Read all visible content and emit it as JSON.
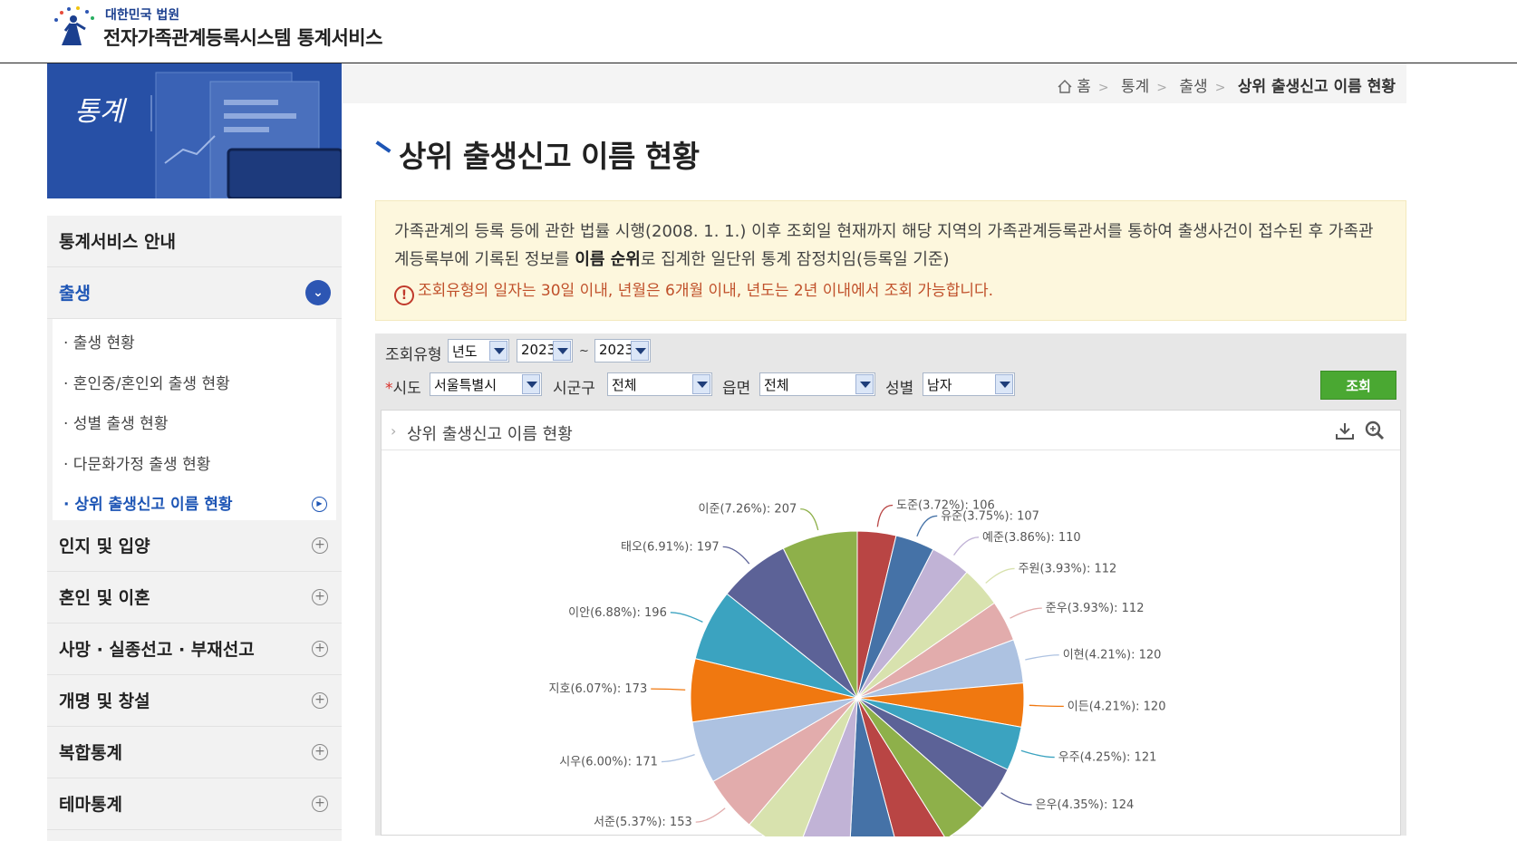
{
  "header": {
    "org_name": "대한민국 법원",
    "site_name": "전자가족관계등록시스템 통계서비스"
  },
  "banner": {
    "title": "통계"
  },
  "sidebar": {
    "items": [
      {
        "label": "통계서비스 안내"
      },
      {
        "label": "출생"
      },
      {
        "label": "인지 및 입양"
      },
      {
        "label": "혼인 및 이혼"
      },
      {
        "label": "사망 · 실종선고 · 부재선고"
      },
      {
        "label": "개명 및 창설"
      },
      {
        "label": "복합통계"
      },
      {
        "label": "테마통계"
      }
    ],
    "sub_items": [
      {
        "label": "· 출생 현황"
      },
      {
        "label": "· 혼인중/혼인외 출생 현황"
      },
      {
        "label": "· 성별 출생 현황"
      },
      {
        "label": "· 다문화가정 출생 현황"
      },
      {
        "label": "· 상위 출생신고 이름 현황"
      }
    ]
  },
  "breadcrumb": [
    "홈",
    "통계",
    "출생",
    "상위 출생신고 이름 현황"
  ],
  "page_title": "상위 출생신고 이름 현황",
  "notice": {
    "text1": "가족관계의 등록 등에 관한 법률 시행(2008. 1. 1.) 이후 조회일 현재까지 해당 지역의 가족관계등록관서를 통하여 출생사건이 접수된 후 가족관계등록부에 기록된 정보를 ",
    "bold": "이름 순위",
    "text2": "로 집계한 일단위 통계 잠정치임(등록일 기준)",
    "warning": "조회유형의 일자는 30일 이내, 년월은 6개월 이내, 년도는 2년 이내에서 조회 가능합니다."
  },
  "filter": {
    "type_label": "조회유형",
    "type_value": "년도",
    "from_year": "2023",
    "tilde": "~",
    "to_year": "2023",
    "sido_star": "*",
    "sido_label": "시도",
    "sido_value": "서울특별시",
    "sigungu_label": "시군구",
    "sigungu_value": "전체",
    "eupmyeon_label": "읍면",
    "eupmyeon_value": "전체",
    "gender_label": "성별",
    "gender_value": "남자",
    "search_button": "조회"
  },
  "panel": {
    "title": "상위 출생신고 이름 현황"
  },
  "chart_data": {
    "type": "pie",
    "slices": [
      {
        "label": "도준(3.72%): 106",
        "value": 106,
        "color": "#b94544"
      },
      {
        "label": "유준(3.75%): 107",
        "value": 107,
        "color": "#4572a7"
      },
      {
        "label": "예준(3.86%): 110",
        "value": 110,
        "color": "#c1b3d6"
      },
      {
        "label": "주원(3.93%): 112",
        "value": 112,
        "color": "#d8e2ae"
      },
      {
        "label": "준우(3.93%): 112",
        "value": 112,
        "color": "#e2acac"
      },
      {
        "label": "이현(4.21%): 120",
        "value": 120,
        "color": "#adc2e1"
      },
      {
        "label": "이든(4.21%): 120",
        "value": 120,
        "color": "#f07810"
      },
      {
        "label": "우주(4.25%): 121",
        "value": 121,
        "color": "#3ba3c0"
      },
      {
        "label": "은우(4.35%): 124",
        "value": 124,
        "color": "#5c6297"
      },
      {
        "label": "",
        "value": 130,
        "color": "#8eb04a"
      },
      {
        "label": "",
        "value": 135,
        "color": "#b94544"
      },
      {
        "label": "",
        "value": 140,
        "color": "#4572a7"
      },
      {
        "label": "",
        "value": 145,
        "color": "#c1b3d6"
      },
      {
        "label": "",
        "value": 150,
        "color": "#d8e2ae"
      },
      {
        "label": "서준(5.37%): 153",
        "value": 153,
        "color": "#e2acac"
      },
      {
        "label": "시우(6.00%): 171",
        "value": 171,
        "color": "#adc2e1"
      },
      {
        "label": "지호(6.07%): 173",
        "value": 173,
        "color": "#f07810"
      },
      {
        "label": "이안(6.88%): 196",
        "value": 196,
        "color": "#3ba3c0"
      },
      {
        "label": "태오(6.91%): 197",
        "value": 197,
        "color": "#5c6297"
      },
      {
        "label": "이준(7.26%): 207",
        "value": 207,
        "color": "#8eb04a"
      }
    ]
  }
}
